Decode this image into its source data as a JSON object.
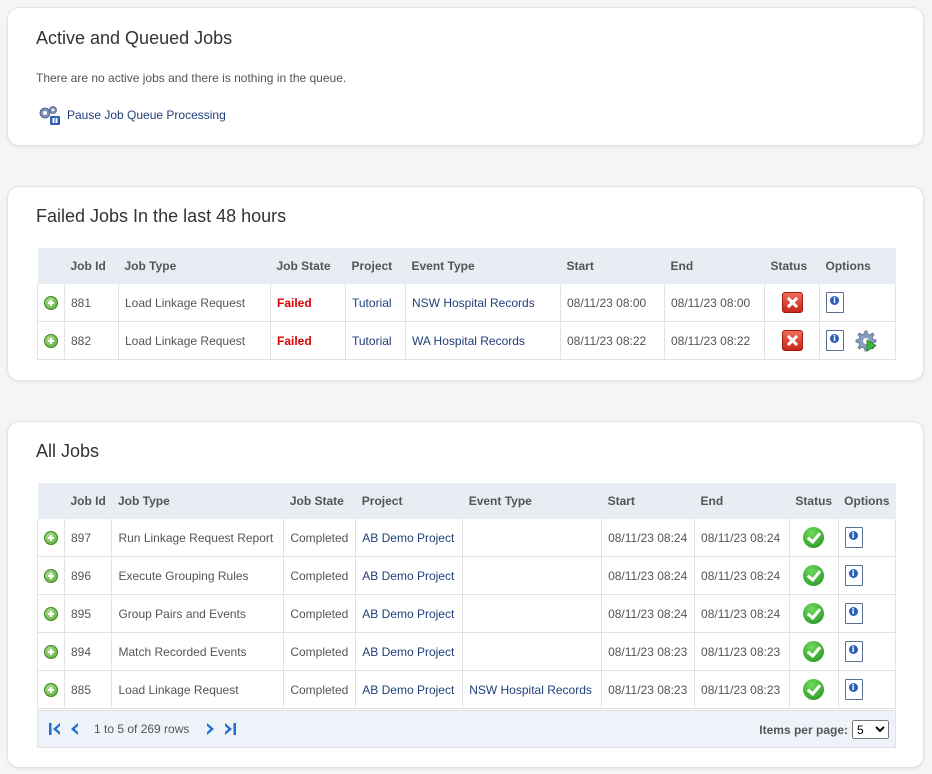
{
  "active": {
    "title": "Active and Queued Jobs",
    "message": "There are no active jobs and there is nothing in the queue.",
    "pause_label": "Pause Job Queue Processing"
  },
  "failed": {
    "title": "Failed Jobs In the last 48 hours",
    "headers": [
      "Job Id",
      "Job Type",
      "Job State",
      "Project",
      "Event Type",
      "Start",
      "End",
      "Status",
      "Options"
    ],
    "rows": [
      {
        "id": "881",
        "type": "Load Linkage Request",
        "state": "Failed",
        "project": "Tutorial",
        "event_type": "NSW Hospital Records",
        "start": "08/11/23 08:00",
        "end": "08/11/23 08:00",
        "status": "error-icon",
        "options": [
          "info-icon"
        ]
      },
      {
        "id": "882",
        "type": "Load Linkage Request",
        "state": "Failed",
        "project": "Tutorial",
        "event_type": "WA Hospital Records",
        "start": "08/11/23 08:22",
        "end": "08/11/23 08:22",
        "status": "error-icon",
        "options": [
          "info-icon",
          "rerun-gear-icon"
        ]
      }
    ]
  },
  "all": {
    "title": "All Jobs",
    "headers": [
      "Job Id",
      "Job Type",
      "Job State",
      "Project",
      "Event Type",
      "Start",
      "End",
      "Status",
      "Options"
    ],
    "rows": [
      {
        "id": "897",
        "type": "Run Linkage Request Report",
        "state": "Completed",
        "project": "AB Demo Project",
        "event_type": "",
        "start": "08/11/23 08:24",
        "end": "08/11/23 08:24",
        "status": "success-icon"
      },
      {
        "id": "896",
        "type": "Execute Grouping Rules",
        "state": "Completed",
        "project": "AB Demo Project",
        "event_type": "",
        "start": "08/11/23 08:24",
        "end": "08/11/23 08:24",
        "status": "success-icon"
      },
      {
        "id": "895",
        "type": "Group Pairs and Events",
        "state": "Completed",
        "project": "AB Demo Project",
        "event_type": "",
        "start": "08/11/23 08:24",
        "end": "08/11/23 08:24",
        "status": "success-icon"
      },
      {
        "id": "894",
        "type": "Match Recorded Events",
        "state": "Completed",
        "project": "AB Demo Project",
        "event_type": "",
        "start": "08/11/23 08:23",
        "end": "08/11/23 08:23",
        "status": "success-icon"
      },
      {
        "id": "885",
        "type": "Load Linkage Request",
        "state": "Completed",
        "project": "AB Demo Project",
        "event_type": "NSW Hospital Records",
        "start": "08/11/23 08:23",
        "end": "08/11/23 08:23",
        "status": "success-icon"
      }
    ],
    "pager": {
      "rows_text": "1 to 5 of 269 rows",
      "items_per_page_label": "Items per page:",
      "items_per_page": "5"
    }
  }
}
